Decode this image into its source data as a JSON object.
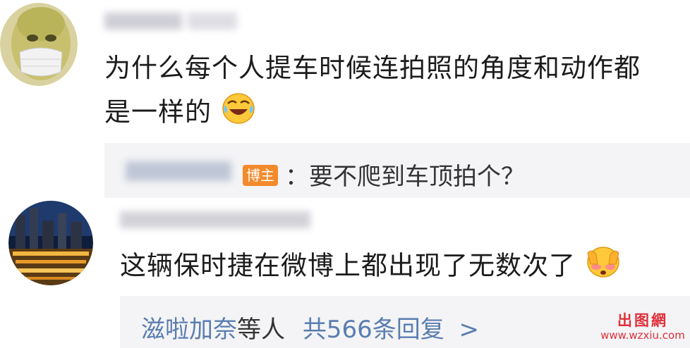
{
  "comments": [
    {
      "text_line1": "为什么每个人提车时候连拍照的角度和动作都",
      "text_line2": "是一样的",
      "emoji": "laughing-crying-emoji",
      "reply": {
        "badge": "博主",
        "text": "：要不爬到车顶拍个？"
      }
    },
    {
      "text": "这辆保时捷在微博上都出现了无数次了",
      "emoji": "shy-covering-face-emoji",
      "replies_summary": {
        "names": "滋啦加奈",
        "middle": "等人",
        "count_text": "共566条回复",
        "chevron": ">"
      }
    }
  ],
  "watermark": {
    "logo_text": "出图網",
    "url": "www.wzxiu.com"
  },
  "colors": {
    "link": "#5a7db0",
    "badge_bg": "#f38a2c",
    "reply_bg": "#f4f4f6",
    "watermark": "#e0303a"
  }
}
